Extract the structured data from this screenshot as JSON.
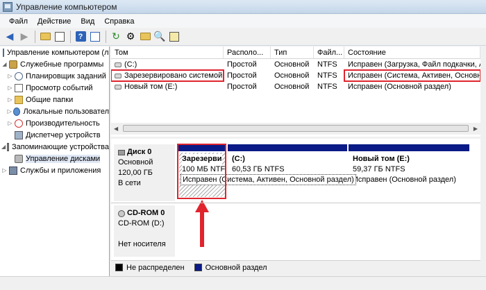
{
  "window": {
    "title": "Управление компьютером"
  },
  "menu": [
    "Файл",
    "Действие",
    "Вид",
    "Справка"
  ],
  "toolbar": {
    "icons": [
      "back-arrow-icon",
      "forward-arrow-icon",
      "up-folder-icon",
      "show-tree-icon",
      "help-icon",
      "console-icon",
      "refresh-icon",
      "properties-icon",
      "open-folder-icon",
      "search-icon",
      "export-icon"
    ]
  },
  "tree": [
    {
      "label": "Управление компьютером (ло",
      "icon": "computer-icon",
      "indent": 0,
      "expander": ""
    },
    {
      "label": "Служебные программы",
      "icon": "tools-icon",
      "indent": 1,
      "expander": "◢"
    },
    {
      "label": "Планировщик заданий",
      "icon": "clock-icon",
      "indent": 2,
      "expander": "▷"
    },
    {
      "label": "Просмотр событий",
      "icon": "event-viewer-icon",
      "indent": 2,
      "expander": "▷"
    },
    {
      "label": "Общие папки",
      "icon": "shared-folder-icon",
      "indent": 2,
      "expander": "▷"
    },
    {
      "label": "Локальные пользовател",
      "icon": "users-icon",
      "indent": 2,
      "expander": "▷"
    },
    {
      "label": "Производительность",
      "icon": "performance-icon",
      "indent": 2,
      "expander": "▷"
    },
    {
      "label": "Диспетчер устройств",
      "icon": "device-manager-icon",
      "indent": 2,
      "expander": ""
    },
    {
      "label": "Запоминающие устройства",
      "icon": "storage-icon",
      "indent": 1,
      "expander": "◢"
    },
    {
      "label": "Управление дисками",
      "icon": "disk-management-icon",
      "indent": 2,
      "expander": "",
      "selected": true
    },
    {
      "label": "Службы и приложения",
      "icon": "services-icon",
      "indent": 1,
      "expander": "▷"
    }
  ],
  "volumes": {
    "headers": [
      "Том",
      "Располо...",
      "Тип",
      "Файл...",
      "Состояние"
    ],
    "rows": [
      {
        "name": "(C:)",
        "layout": "Простой",
        "type": "Основной",
        "fs": "NTFS",
        "status": "Исправен (Загрузка, Файл подкачки, А",
        "highlight": false
      },
      {
        "name": "Зарезервировано системой",
        "layout": "Простой",
        "type": "Основной",
        "fs": "NTFS",
        "status": "Исправен (Система, Активен, Основн",
        "highlight": true
      },
      {
        "name": "Новый том (E:)",
        "layout": "Простой",
        "type": "Основной",
        "fs": "NTFS",
        "status": "Исправен (Основной раздел)",
        "highlight": false
      }
    ]
  },
  "disks": {
    "disk0": {
      "title": "Диск 0",
      "type": "Основной",
      "size": "120,00 ГБ",
      "state": "В сети",
      "partitions": [
        {
          "name": "Зарезерви",
          "size": "100 МБ NTF",
          "status": "Исправен (Система, Активен, Основной раздел)"
        },
        {
          "name": "(C:)",
          "size": "60,53 ГБ NTFS",
          "status": ""
        },
        {
          "name": "Новый том  (E:)",
          "size": "59,37 ГБ NTFS",
          "status": "Исправен (Основной раздел)"
        }
      ]
    },
    "cdrom0": {
      "title": "CD-ROM 0",
      "device": "CD-ROM (D:)",
      "state": "Нет носителя"
    }
  },
  "legend": {
    "unallocated": "Не распределен",
    "primary": "Основной раздел",
    "colors": {
      "unallocated": "#000000",
      "primary": "#0a1a86",
      "highlight": "#e0242e"
    }
  }
}
